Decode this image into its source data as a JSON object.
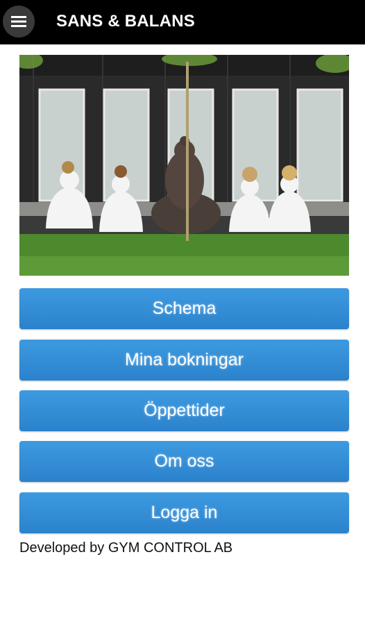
{
  "header": {
    "title": "SANS & BALANS",
    "menu_icon": "hamburger-menu-icon"
  },
  "hero": {
    "description": "meditation-photo"
  },
  "menu": {
    "schema": "Schema",
    "bookings": "Mina bokningar",
    "hours": "Öppettider",
    "about": "Om oss",
    "login": "Logga in"
  },
  "footer": {
    "text": "Developed by GYM CONTROL AB"
  },
  "colors": {
    "header_bg": "#000000",
    "button_bg": "#3190d8",
    "button_text": "#ffffff"
  }
}
